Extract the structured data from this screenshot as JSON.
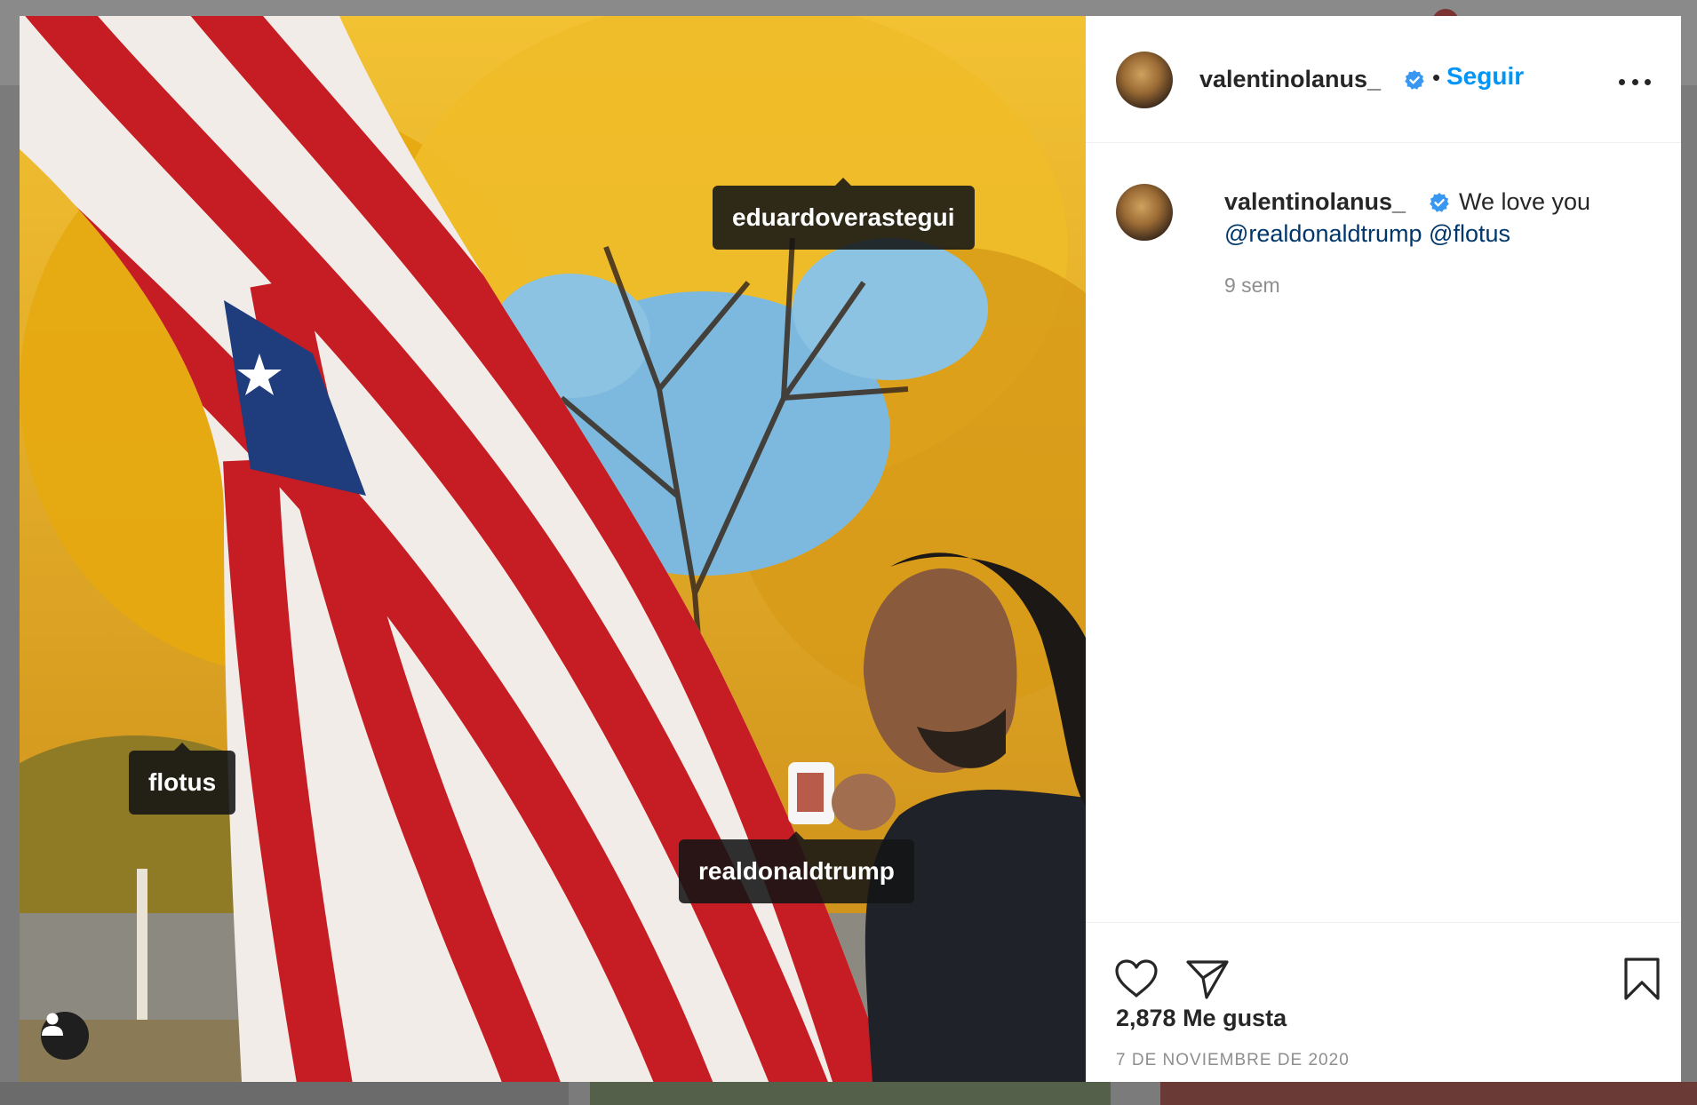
{
  "post": {
    "author": "valentinolanus_",
    "follow_label": "Seguir",
    "separator": "•",
    "caption_text": "We love you",
    "mentions": [
      "@realdonaldtrump",
      "@flotus"
    ],
    "time_ago": "9 sem",
    "likes_label": "2,878 Me gusta",
    "date": "7 DE NOVIEMBRE DE 2020"
  },
  "photo_tags": {
    "eduardo": "eduardoverastegui",
    "flotus": "flotus",
    "trump": "realdonaldtrump"
  },
  "icons": {
    "verified": "verified-badge-icon",
    "more": "more-options-icon",
    "like": "heart-icon",
    "share": "paper-plane-icon",
    "save": "bookmark-icon",
    "tagged": "user-icon"
  },
  "colors": {
    "follow": "#0095f6",
    "mention": "#00376b",
    "verified": "#3897f0",
    "muted": "#8e8e8e"
  }
}
